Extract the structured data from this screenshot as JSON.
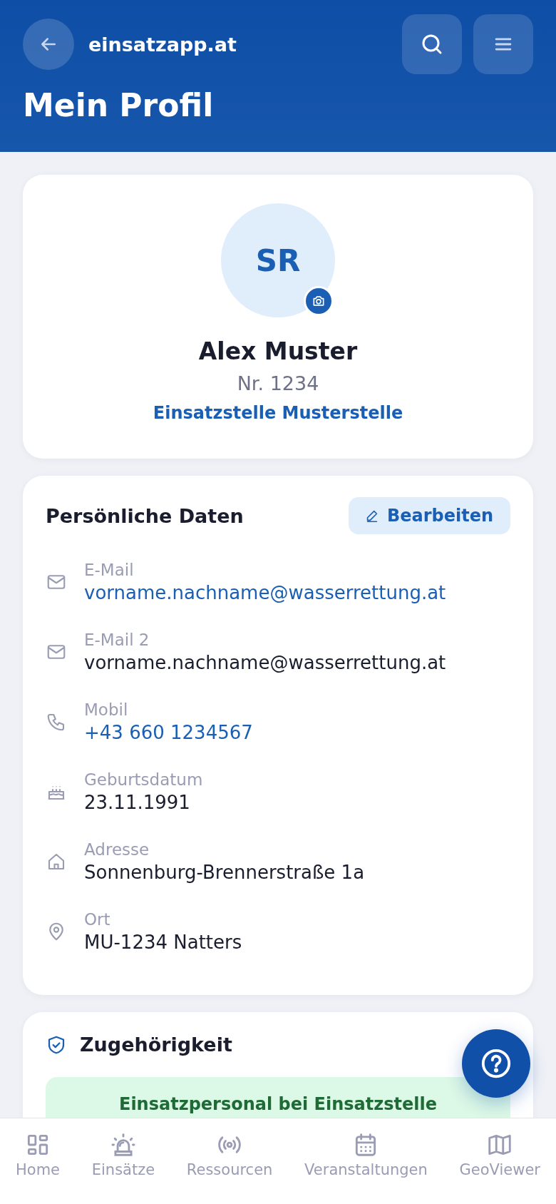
{
  "app_bar": {
    "site": "einsatzapp.at",
    "title": "Mein Profil"
  },
  "profile": {
    "initials": "SR",
    "name": "Alex Muster",
    "number": "Nr. 1234",
    "station": "Einsatzstelle Musterstelle"
  },
  "personal_data": {
    "title": "Persönliche Daten",
    "edit_button": "Bearbeiten",
    "fields": [
      {
        "kind": "email",
        "label": "E-Mail",
        "value": "vorname.nachname@wasserrettung.at",
        "link": true
      },
      {
        "kind": "email",
        "label": "E-Mail 2",
        "value": "vorname.nachname@wasserrettung.at",
        "link": false
      },
      {
        "kind": "phone",
        "label": "Mobil",
        "value": "+43 660 1234567",
        "link": true
      },
      {
        "kind": "birthday",
        "label": "Geburtsdatum",
        "value": "23.11.1991",
        "link": false
      },
      {
        "kind": "home",
        "label": "Adresse",
        "value": "Sonnenburg-Brennerstraße 1a",
        "link": false
      },
      {
        "kind": "location",
        "label": "Ort",
        "value": "MU-1234 Natters",
        "link": false
      }
    ]
  },
  "membership": {
    "title": "Zugehörigkeit",
    "status": "Einsatzpersonal bei Einsatzstelle"
  },
  "bottom_nav": [
    {
      "kind": "home",
      "label": "Home"
    },
    {
      "kind": "siren",
      "label": "Einsätze"
    },
    {
      "kind": "radio",
      "label": "Ressourcen"
    },
    {
      "kind": "calendar",
      "label": "Veranstaltungen"
    },
    {
      "kind": "map",
      "label": "GeoViewer"
    }
  ]
}
